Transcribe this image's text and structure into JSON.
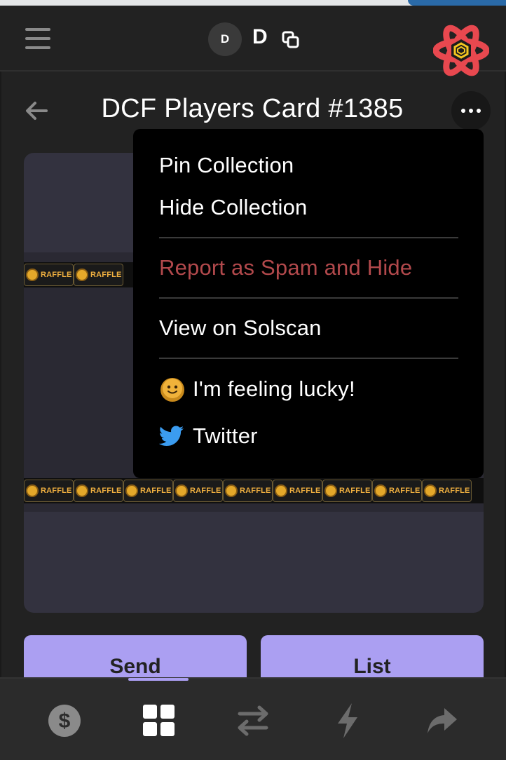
{
  "header": {
    "account_initial": "D",
    "account_name": "D"
  },
  "page": {
    "title": "DCF Players Card #1385"
  },
  "nft": {
    "banner_text": "RAFFLE",
    "top_band_count": 2,
    "bottom_band_count": 9
  },
  "actions": {
    "send_label": "Send",
    "list_label": "List"
  },
  "menu": {
    "pin": "Pin Collection",
    "hide": "Hide Collection",
    "report": "Report as Spam and Hide",
    "solscan": "View on Solscan",
    "lucky": "I'm feeling lucky!",
    "twitter": "Twitter"
  },
  "bottom_nav": {
    "items": [
      "tokens-icon",
      "collectibles-icon",
      "swap-icon",
      "activity-icon",
      "send-icon"
    ],
    "active": "collectibles-icon"
  },
  "colors": {
    "background": "#222222",
    "accent": "#ab9ff2",
    "danger": "#b2494c",
    "menu_bg": "#000000"
  }
}
